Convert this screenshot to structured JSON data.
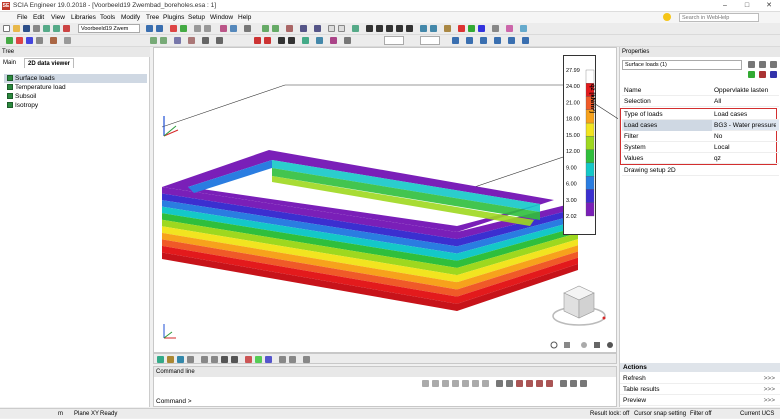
{
  "app": {
    "logo_text": "SE",
    "title": "SCIA Engineer 19.0.2018 - [Voorbeeld19 Zwembad_boreholes.esa : 1]"
  },
  "menu": [
    "File",
    "Edit",
    "View",
    "Libraries",
    "Tools",
    "Modify",
    "Tree",
    "Plugins",
    "Setup",
    "Window",
    "Help"
  ],
  "search": {
    "placeholder": "Search in WebHelp"
  },
  "toolbar": {
    "project_combo": "Voorbeeld19 Zwem"
  },
  "tree": {
    "header": "Tree",
    "tabs": [
      "Main",
      "2D data viewer"
    ],
    "items": [
      "Surface loads",
      "Temperature load",
      "Subsoil",
      "Isotropy"
    ]
  },
  "legend": {
    "title": "qz [kN/m²]",
    "values": [
      "27.99",
      "24.00",
      "21.00",
      "18.00",
      "15.00",
      "12.00",
      "9.00",
      "6.00",
      "3.00",
      "2.02"
    ],
    "colors": [
      "#ffffff",
      "#e31a1c",
      "#f05a28",
      "#f7a21c",
      "#f2e420",
      "#9ed81f",
      "#2fbf3c",
      "#14c8c8",
      "#2a7de1",
      "#3b2fd0",
      "#7a1fb8"
    ]
  },
  "command": {
    "header": "Command line",
    "prompt": "Command >"
  },
  "properties": {
    "header": "Properties",
    "selection_combo": "Surface loads (1)",
    "rows": [
      {
        "key": "Name",
        "value": "Oppervlakte lasten"
      },
      {
        "key": "Selection",
        "value": "All"
      },
      {
        "key": "Type of loads",
        "value": "Load cases"
      },
      {
        "key": "Load cases",
        "value": "BG3 - Water pressure"
      },
      {
        "key": "Filter",
        "value": "No"
      },
      {
        "key": "System",
        "value": "Local"
      },
      {
        "key": "Values",
        "value": "qz"
      },
      {
        "key": "Drawing setup 2D",
        "value": ""
      }
    ]
  },
  "actions": {
    "header": "Actions",
    "items": [
      {
        "label": "Refresh",
        "arrow": ">>>"
      },
      {
        "label": "Table results",
        "arrow": ">>>"
      },
      {
        "label": "Preview",
        "arrow": ">>>"
      }
    ]
  },
  "status": {
    "unit": "m",
    "plane": "Plane XY",
    "ready": "Ready",
    "result_lock": "Result lock: off",
    "cursor_snap": "Cursor snap setting",
    "filter": "Filter off",
    "ucs": "Current UCS"
  }
}
